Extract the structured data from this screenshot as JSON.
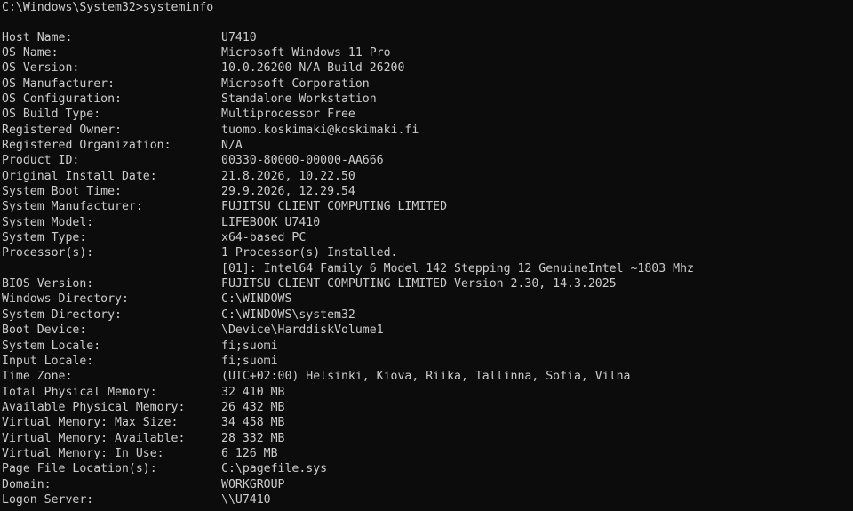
{
  "prompt": "C:\\Windows\\System32>",
  "command": "systeminfo",
  "rows": [
    {
      "key": "Host Name:",
      "value": "U7410"
    },
    {
      "key": "OS Name:",
      "value": "Microsoft Windows 11 Pro"
    },
    {
      "key": "OS Version:",
      "value": "10.0.26200 N/A Build 26200"
    },
    {
      "key": "OS Manufacturer:",
      "value": "Microsoft Corporation"
    },
    {
      "key": "OS Configuration:",
      "value": "Standalone Workstation"
    },
    {
      "key": "OS Build Type:",
      "value": "Multiprocessor Free"
    },
    {
      "key": "Registered Owner:",
      "value": "tuomo.koskimaki@koskimaki.fi"
    },
    {
      "key": "Registered Organization:",
      "value": "N/A"
    },
    {
      "key": "Product ID:",
      "value": "00330-80000-00000-AA666"
    },
    {
      "key": "Original Install Date:",
      "value": "21.8.2026, 10.22.50"
    },
    {
      "key": "System Boot Time:",
      "value": "29.9.2026, 12.29.54"
    },
    {
      "key": "System Manufacturer:",
      "value": "FUJITSU CLIENT COMPUTING LIMITED"
    },
    {
      "key": "System Model:",
      "value": "LIFEBOOK U7410"
    },
    {
      "key": "System Type:",
      "value": "x64-based PC"
    },
    {
      "key": "Processor(s):",
      "value": "1 Processor(s) Installed."
    },
    {
      "key": "",
      "value": "[01]: Intel64 Family 6 Model 142 Stepping 12 GenuineIntel ~1803 Mhz"
    },
    {
      "key": "BIOS Version:",
      "value": "FUJITSU CLIENT COMPUTING LIMITED Version 2.30, 14.3.2025"
    },
    {
      "key": "Windows Directory:",
      "value": "C:\\WINDOWS"
    },
    {
      "key": "System Directory:",
      "value": "C:\\WINDOWS\\system32"
    },
    {
      "key": "Boot Device:",
      "value": "\\Device\\HarddiskVolume1"
    },
    {
      "key": "System Locale:",
      "value": "fi;suomi"
    },
    {
      "key": "Input Locale:",
      "value": "fi;suomi"
    },
    {
      "key": "Time Zone:",
      "value": "(UTC+02:00) Helsinki, Kiova, Riika, Tallinna, Sofia, Vilna"
    },
    {
      "key": "Total Physical Memory:",
      "value": "32 410 MB"
    },
    {
      "key": "Available Physical Memory:",
      "value": "26 432 MB"
    },
    {
      "key": "Virtual Memory: Max Size:",
      "value": "34 458 MB"
    },
    {
      "key": "Virtual Memory: Available:",
      "value": "28 332 MB"
    },
    {
      "key": "Virtual Memory: In Use:",
      "value": "6 126 MB"
    },
    {
      "key": "Page File Location(s):",
      "value": "C:\\pagefile.sys"
    },
    {
      "key": "Domain:",
      "value": "WORKGROUP"
    },
    {
      "key": "Logon Server:",
      "value": "\\\\U7410"
    }
  ]
}
